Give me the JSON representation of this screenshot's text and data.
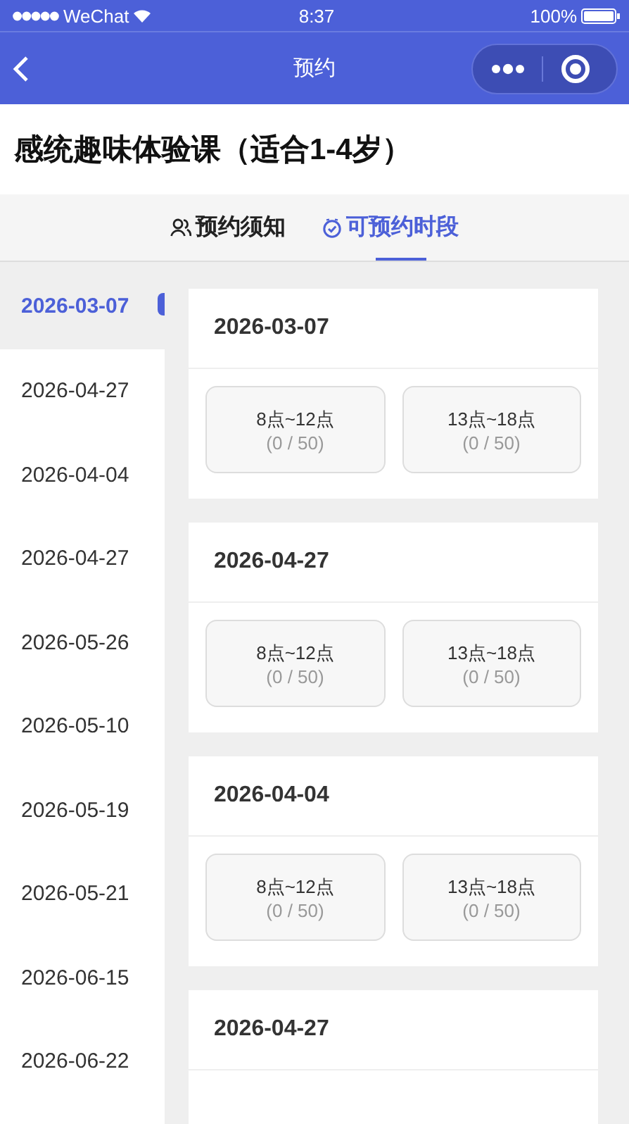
{
  "status_bar": {
    "carrier": "WeChat",
    "time": "8:37",
    "battery": "100%"
  },
  "nav": {
    "title": "预约"
  },
  "course": {
    "title": "感统趣味体验课（适合1-4岁）"
  },
  "tabs": [
    {
      "label": "预约须知",
      "selected": false
    },
    {
      "label": "可预约时段",
      "selected": true
    }
  ],
  "sidebar": {
    "items": [
      {
        "label": "2026-03-07",
        "selected": true
      },
      {
        "label": "2026-04-27",
        "selected": false
      },
      {
        "label": "2026-04-04",
        "selected": false
      },
      {
        "label": "2026-04-27",
        "selected": false
      },
      {
        "label": "2026-05-26",
        "selected": false
      },
      {
        "label": "2026-05-10",
        "selected": false
      },
      {
        "label": "2026-05-19",
        "selected": false
      },
      {
        "label": "2026-05-21",
        "selected": false
      },
      {
        "label": "2026-06-15",
        "selected": false
      },
      {
        "label": "2026-06-22",
        "selected": false
      }
    ]
  },
  "days": [
    {
      "date": "2026-03-07",
      "slots": [
        {
          "time": "8点~12点",
          "count": "(0 / 50)"
        },
        {
          "time": "13点~18点",
          "count": "(0 / 50)"
        }
      ]
    },
    {
      "date": "2026-04-27",
      "slots": [
        {
          "time": "8点~12点",
          "count": "(0 / 50)"
        },
        {
          "time": "13点~18点",
          "count": "(0 / 50)"
        }
      ]
    },
    {
      "date": "2026-04-04",
      "slots": [
        {
          "time": "8点~12点",
          "count": "(0 / 50)"
        },
        {
          "time": "13点~18点",
          "count": "(0 / 50)"
        }
      ]
    },
    {
      "date": "2026-04-27"
    }
  ]
}
